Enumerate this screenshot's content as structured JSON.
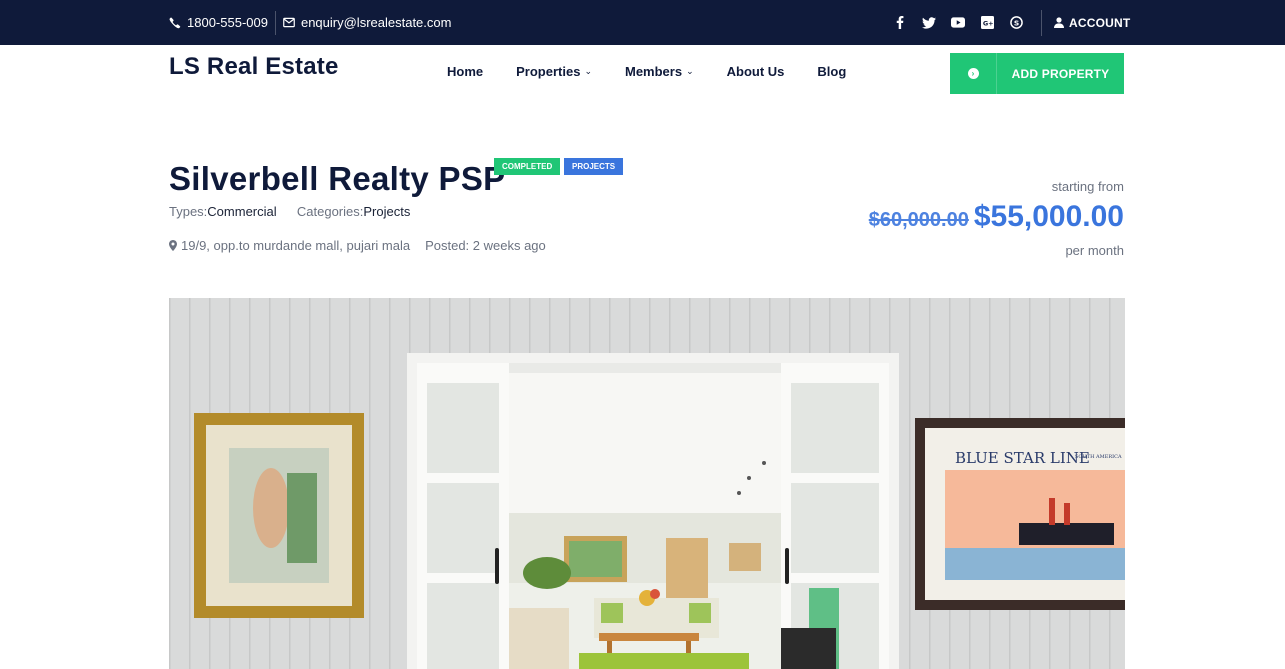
{
  "topbar": {
    "phone": "1800-555-009",
    "email": "enquiry@lsrealestate.com",
    "social": [
      "facebook-icon",
      "twitter-icon",
      "youtube-icon",
      "google-plus-icon",
      "skype-icon"
    ],
    "account_label": "ACCOUNT"
  },
  "header": {
    "logo": "LS Real Estate",
    "nav": [
      {
        "label": "Home",
        "dropdown": false
      },
      {
        "label": "Properties",
        "dropdown": true
      },
      {
        "label": "Members",
        "dropdown": true
      },
      {
        "label": "About Us",
        "dropdown": false
      },
      {
        "label": "Blog",
        "dropdown": false
      }
    ],
    "add_property_label": "ADD PROPERTY"
  },
  "listing": {
    "title": "Silverbell Realty PSP",
    "badges": [
      "COMPLETED",
      "PROJECTS"
    ],
    "types_label": "Types:",
    "types_value": "Commercial",
    "categories_label": "Categories:",
    "categories_value": "Projects",
    "address": "19/9, opp.to murdande mall, pujari mala",
    "posted": "Posted: 2 weeks ago",
    "starting_from": "starting from",
    "old_price": "$60,000.00",
    "price": "$55,000.00",
    "per": "per month",
    "poster_title": "BLUE STAR LINE",
    "poster_sub": "SOUTH AMERICA"
  },
  "colors": {
    "navy": "#0f1a3a",
    "green": "#20c676",
    "blue": "#3a75dd"
  }
}
